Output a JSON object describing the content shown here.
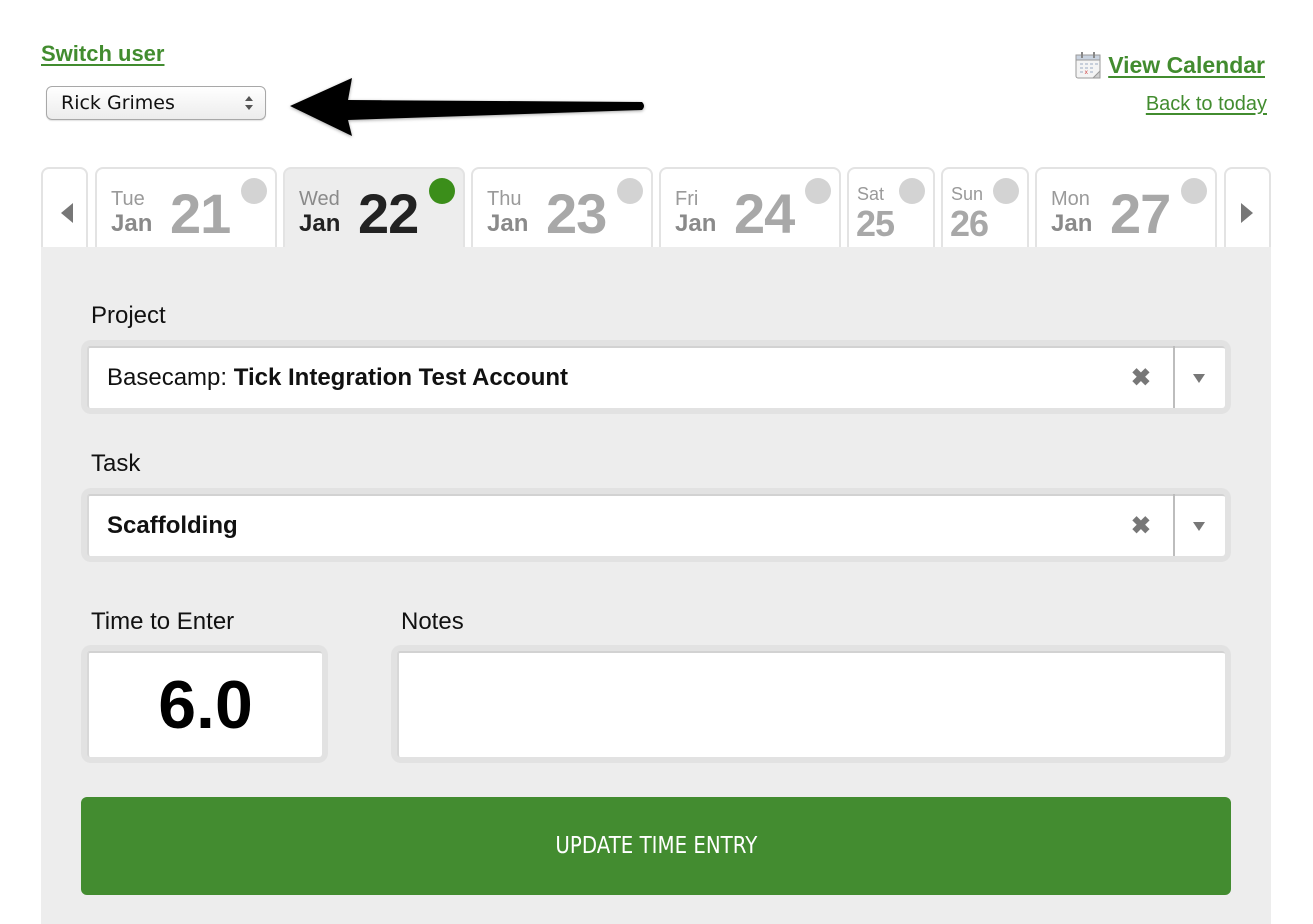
{
  "header": {
    "switch_user_label": "Switch user",
    "selected_user": "Rick Grimes",
    "view_calendar_label": "View Calendar",
    "back_to_today_label": "Back to today"
  },
  "colors": {
    "brand_green": "#438c30",
    "status_logged": "#3b8e1a",
    "status_empty": "#d3d3d3",
    "panel_bg": "#ededed"
  },
  "day_tabs": [
    {
      "dow": "Tue",
      "month": "Jan",
      "day": "21",
      "has_entries": false,
      "active": false
    },
    {
      "dow": "Wed",
      "month": "Jan",
      "day": "22",
      "has_entries": true,
      "active": true
    },
    {
      "dow": "Thu",
      "month": "Jan",
      "day": "23",
      "has_entries": false,
      "active": false
    },
    {
      "dow": "Fri",
      "month": "Jan",
      "day": "24",
      "has_entries": false,
      "active": false
    },
    {
      "dow": "Sat",
      "month": "",
      "day": "25",
      "has_entries": false,
      "active": false
    },
    {
      "dow": "Sun",
      "month": "",
      "day": "26",
      "has_entries": false,
      "active": false
    },
    {
      "dow": "Mon",
      "month": "Jan",
      "day": "27",
      "has_entries": false,
      "active": false
    }
  ],
  "form": {
    "project_label": "Project",
    "project_prefix": "Basecamp: ",
    "project_value": "Tick Integration Test Account",
    "task_label": "Task",
    "task_value": "Scaffolding",
    "time_label": "Time to Enter",
    "time_value": "6.0",
    "notes_label": "Notes",
    "notes_value": "",
    "clear_glyph": "✖",
    "submit_label": "UPDATE TIME ENTRY"
  }
}
